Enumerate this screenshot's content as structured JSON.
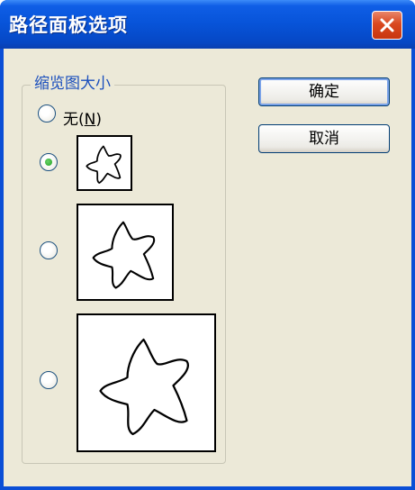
{
  "window": {
    "title": "路径面板选项",
    "close_icon": "close-x-icon",
    "accent_color": "#0a4ed6",
    "close_color": "#d9481f"
  },
  "thumbnail_group": {
    "label": "缩览图大小",
    "options": [
      {
        "label_prefix": "无(",
        "mnemonic": "N",
        "label_suffix": ")",
        "selected": false
      },
      {
        "size": "small",
        "selected": true,
        "icon": "starfish-shape-icon"
      },
      {
        "size": "medium",
        "selected": false,
        "icon": "starfish-shape-icon"
      },
      {
        "size": "large",
        "selected": false,
        "icon": "starfish-shape-icon"
      }
    ]
  },
  "buttons": {
    "ok": "确定",
    "cancel": "取消"
  }
}
